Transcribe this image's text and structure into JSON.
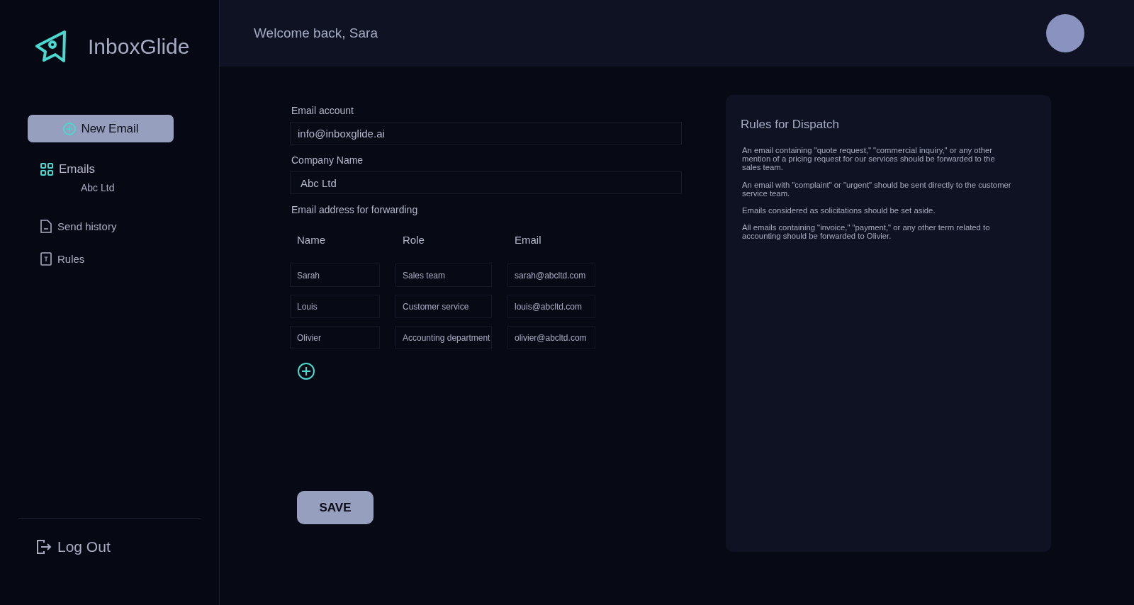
{
  "sidebar": {
    "app_name": "InboxGlide",
    "new_email_button": "New Email",
    "items": [
      {
        "label": "Emails",
        "kind": "grid",
        "selected": true,
        "children": [
          {
            "label": "Abc Ltd"
          }
        ]
      },
      {
        "label": "Send history",
        "kind": "document",
        "selected": false
      },
      {
        "label": "Rules",
        "kind": "text",
        "selected": false
      }
    ],
    "logout": "Log Out"
  },
  "header": {
    "greeting": "Welcome back, Sara"
  },
  "form": {
    "email_account": {
      "label": "Email account",
      "value": "info@inboxglide.ai"
    },
    "company_name": {
      "label": "Company Name",
      "value": "Abc Ltd"
    },
    "forwarding": {
      "label": "Email address for forwarding",
      "columns": [
        "Name",
        "Role",
        "Email"
      ],
      "rows": [
        [
          "Sarah",
          "Sales team",
          "sarah@abcltd.com"
        ],
        [
          "Louis",
          "Customer service",
          "louis@abcltd.com"
        ],
        [
          "Olivier",
          "Accounting department",
          "olivier@abcltd.com"
        ]
      ]
    },
    "save_button": "SAVE"
  },
  "rules_panel": {
    "title": "Rules for Dispatch",
    "paragraphs": [
      "An email containing \"quote request,\" \"commercial inquiry,\" or any other mention of a pricing request for our services should be forwarded to the sales team.",
      "An email with \"complaint\" or \"urgent\" should be sent directly to the customer service team.",
      "Emails considered as solicitations should be set aside.",
      "All emails containing \"invoice,\" \"payment,\" or any other term related to accounting should be forwarded to Olivier."
    ]
  }
}
